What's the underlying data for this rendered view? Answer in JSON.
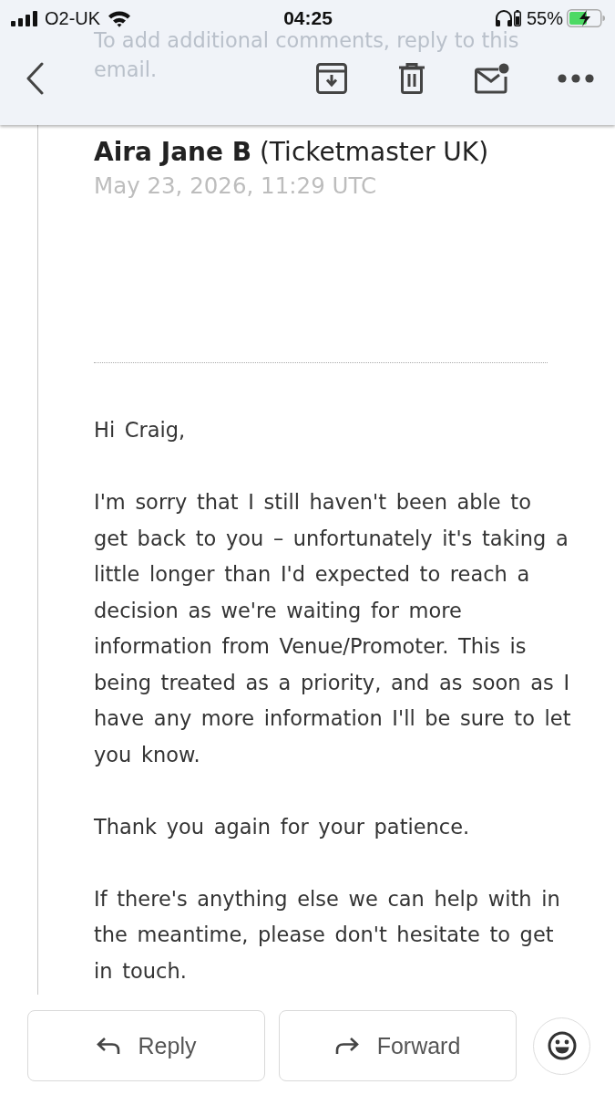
{
  "status_bar": {
    "carrier": "O2-UK",
    "time": "04:25",
    "battery_percent": "55%"
  },
  "scrolled_text": [
    "To add additional comments, reply to this",
    "email."
  ],
  "message": {
    "sender": "**Aira Jane B** (Ticketmaster UK)",
    "date": "May 23, 2026, 11:29 UTC",
    "body": [
      "Hi Craig,",
      "I'm sorry that I still haven't been able to get back to you – unfortunately it's taking a little longer than I'd expected to reach a decision as we're waiting for more information from Venue/Promoter. This is being treated as a priority, and as soon as I have any more information I'll be sure to let you know.",
      "Thank you again for your patience.",
      "If there's anything else we can help with in the meantime, please don't hesitate to get in touch."
    ]
  },
  "actions": [
    {
      "kind": "reply",
      "label": "Reply"
    },
    {
      "kind": "forward",
      "label": "Forward"
    }
  ]
}
